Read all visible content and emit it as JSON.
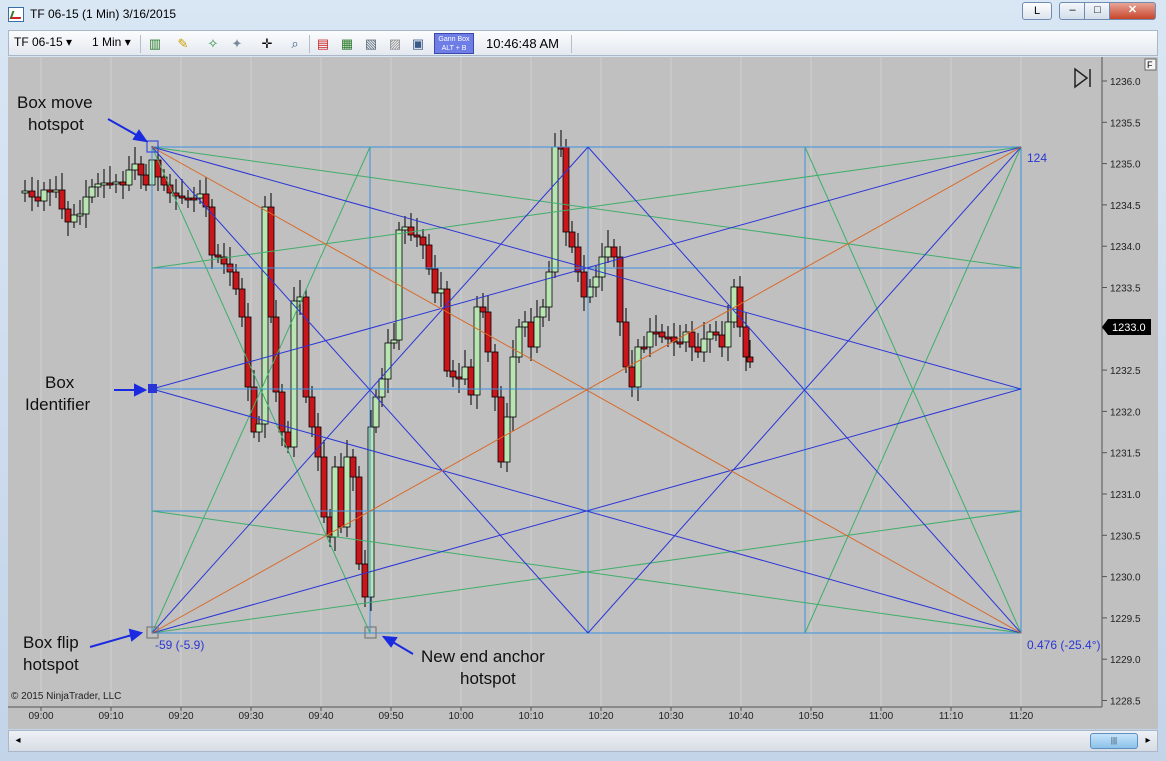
{
  "window": {
    "title": "TF 06-15 (1 Min)  3/16/2015",
    "layout_button": "L",
    "minimize_glyph": "–",
    "maximize_glyph": "□",
    "close_glyph": "✕"
  },
  "toolbar": {
    "instrument": "TF 06-15",
    "interval": "1 Min",
    "gann_line1": "Gann Box",
    "gann_line2": "ALT + B",
    "time": "10:46:48 AM"
  },
  "chart": {
    "price_axis": [
      "1236.0",
      "1235.5",
      "1235.0",
      "1234.5",
      "1234.0",
      "1233.5",
      "1233.0",
      "1232.5",
      "1232.0",
      "1231.5",
      "1231.0",
      "1230.5",
      "1230.0",
      "1229.5",
      "1229.0",
      "1228.5"
    ],
    "time_axis": [
      "09:00",
      "09:10",
      "09:20",
      "09:30",
      "09:40",
      "09:50",
      "10:00",
      "10:10",
      "10:20",
      "10:30",
      "10:40",
      "10:50",
      "11:00",
      "11:10",
      "11:20"
    ],
    "current_price": "1233.0",
    "copyright": "© 2015 NinjaTrader, LLC",
    "f_button": "F",
    "gann_top_right_label": "124",
    "gann_bottom_left_label": "-59 (-5.9)",
    "gann_bottom_right_label": "0.476 (-25.4°)",
    "annotations": {
      "box_move_1": "Box move",
      "box_move_2": "hotspot",
      "box_id_1": "Box",
      "box_id_2": "Identifier",
      "box_flip_1": "Box flip",
      "box_flip_2": "hotspot",
      "new_end_1": "New end anchor",
      "new_end_2": "hotspot"
    },
    "colors": {
      "background": "#c0c0c0",
      "up_candle": "#b9e5b3",
      "down_candle": "#c8161a",
      "grid_blue": "#3a8fe0",
      "fan_blue": "#2a35d6",
      "fan_green": "#3fae6a",
      "fan_orange": "#d86a2a"
    }
  }
}
